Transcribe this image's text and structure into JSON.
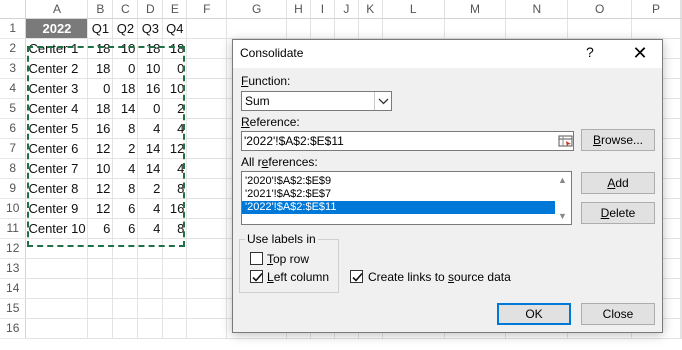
{
  "spreadsheet": {
    "columns": [
      "A",
      "B",
      "C",
      "D",
      "E",
      "F",
      "G",
      "H",
      "I",
      "J",
      "K",
      "L",
      "M",
      "N",
      "O",
      "P"
    ],
    "rows": [
      "1",
      "2",
      "3",
      "4",
      "5",
      "6",
      "7",
      "8",
      "9",
      "10",
      "11",
      "12",
      "13",
      "14",
      "15",
      "16"
    ],
    "header": [
      "2022",
      "Q1",
      "Q2",
      "Q3",
      "Q4"
    ],
    "data": [
      [
        "Center 1",
        "18",
        "10",
        "18",
        "18"
      ],
      [
        "Center 2",
        "18",
        "0",
        "10",
        "0"
      ],
      [
        "Center 3",
        "0",
        "18",
        "16",
        "10"
      ],
      [
        "Center 4",
        "18",
        "14",
        "0",
        "2"
      ],
      [
        "Center 5",
        "16",
        "8",
        "4",
        "4"
      ],
      [
        "Center 6",
        "12",
        "2",
        "14",
        "12"
      ],
      [
        "Center 7",
        "10",
        "4",
        "14",
        "4"
      ],
      [
        "Center 8",
        "12",
        "8",
        "2",
        "8"
      ],
      [
        "Center 9",
        "12",
        "6",
        "4",
        "16"
      ],
      [
        "Center 10",
        "6",
        "6",
        "4",
        "8"
      ]
    ]
  },
  "dialog": {
    "title": "Consolidate",
    "help": "?",
    "close": "✕",
    "function_label_u": "F",
    "function_label_rest": "unction:",
    "function_value": "Sum",
    "reference_label_u": "R",
    "reference_label_rest": "eference:",
    "reference_value": "'2022'!$A$2:$E$11",
    "browse_u": "B",
    "browse_rest": "rowse...",
    "all_refs_label_u": "e",
    "all_refs_label_pre": "All r",
    "all_refs_label_post": "ferences:",
    "all_references": [
      "'2020'!$A$2:$E$9",
      "'2021'!$A$2:$E$7",
      "'2022'!$A$2:$E$11"
    ],
    "selected_reference_index": 2,
    "add_u": "A",
    "add_rest": "dd",
    "delete_u": "D",
    "delete_rest": "elete",
    "use_labels_in": "Use labels in",
    "top_row_u": "T",
    "top_row_rest": "op row",
    "top_row_checked": false,
    "left_column_u": "L",
    "left_column_rest": "eft column",
    "left_column_checked": true,
    "create_links_pre": "Create links to ",
    "create_links_u": "s",
    "create_links_post": "ource data",
    "create_links_checked": true,
    "ok": "OK",
    "close_button": "Close"
  },
  "colors": {
    "selection": "#0078d7",
    "marquee": "#1e7145",
    "header_fill": "#7a7a7a"
  }
}
